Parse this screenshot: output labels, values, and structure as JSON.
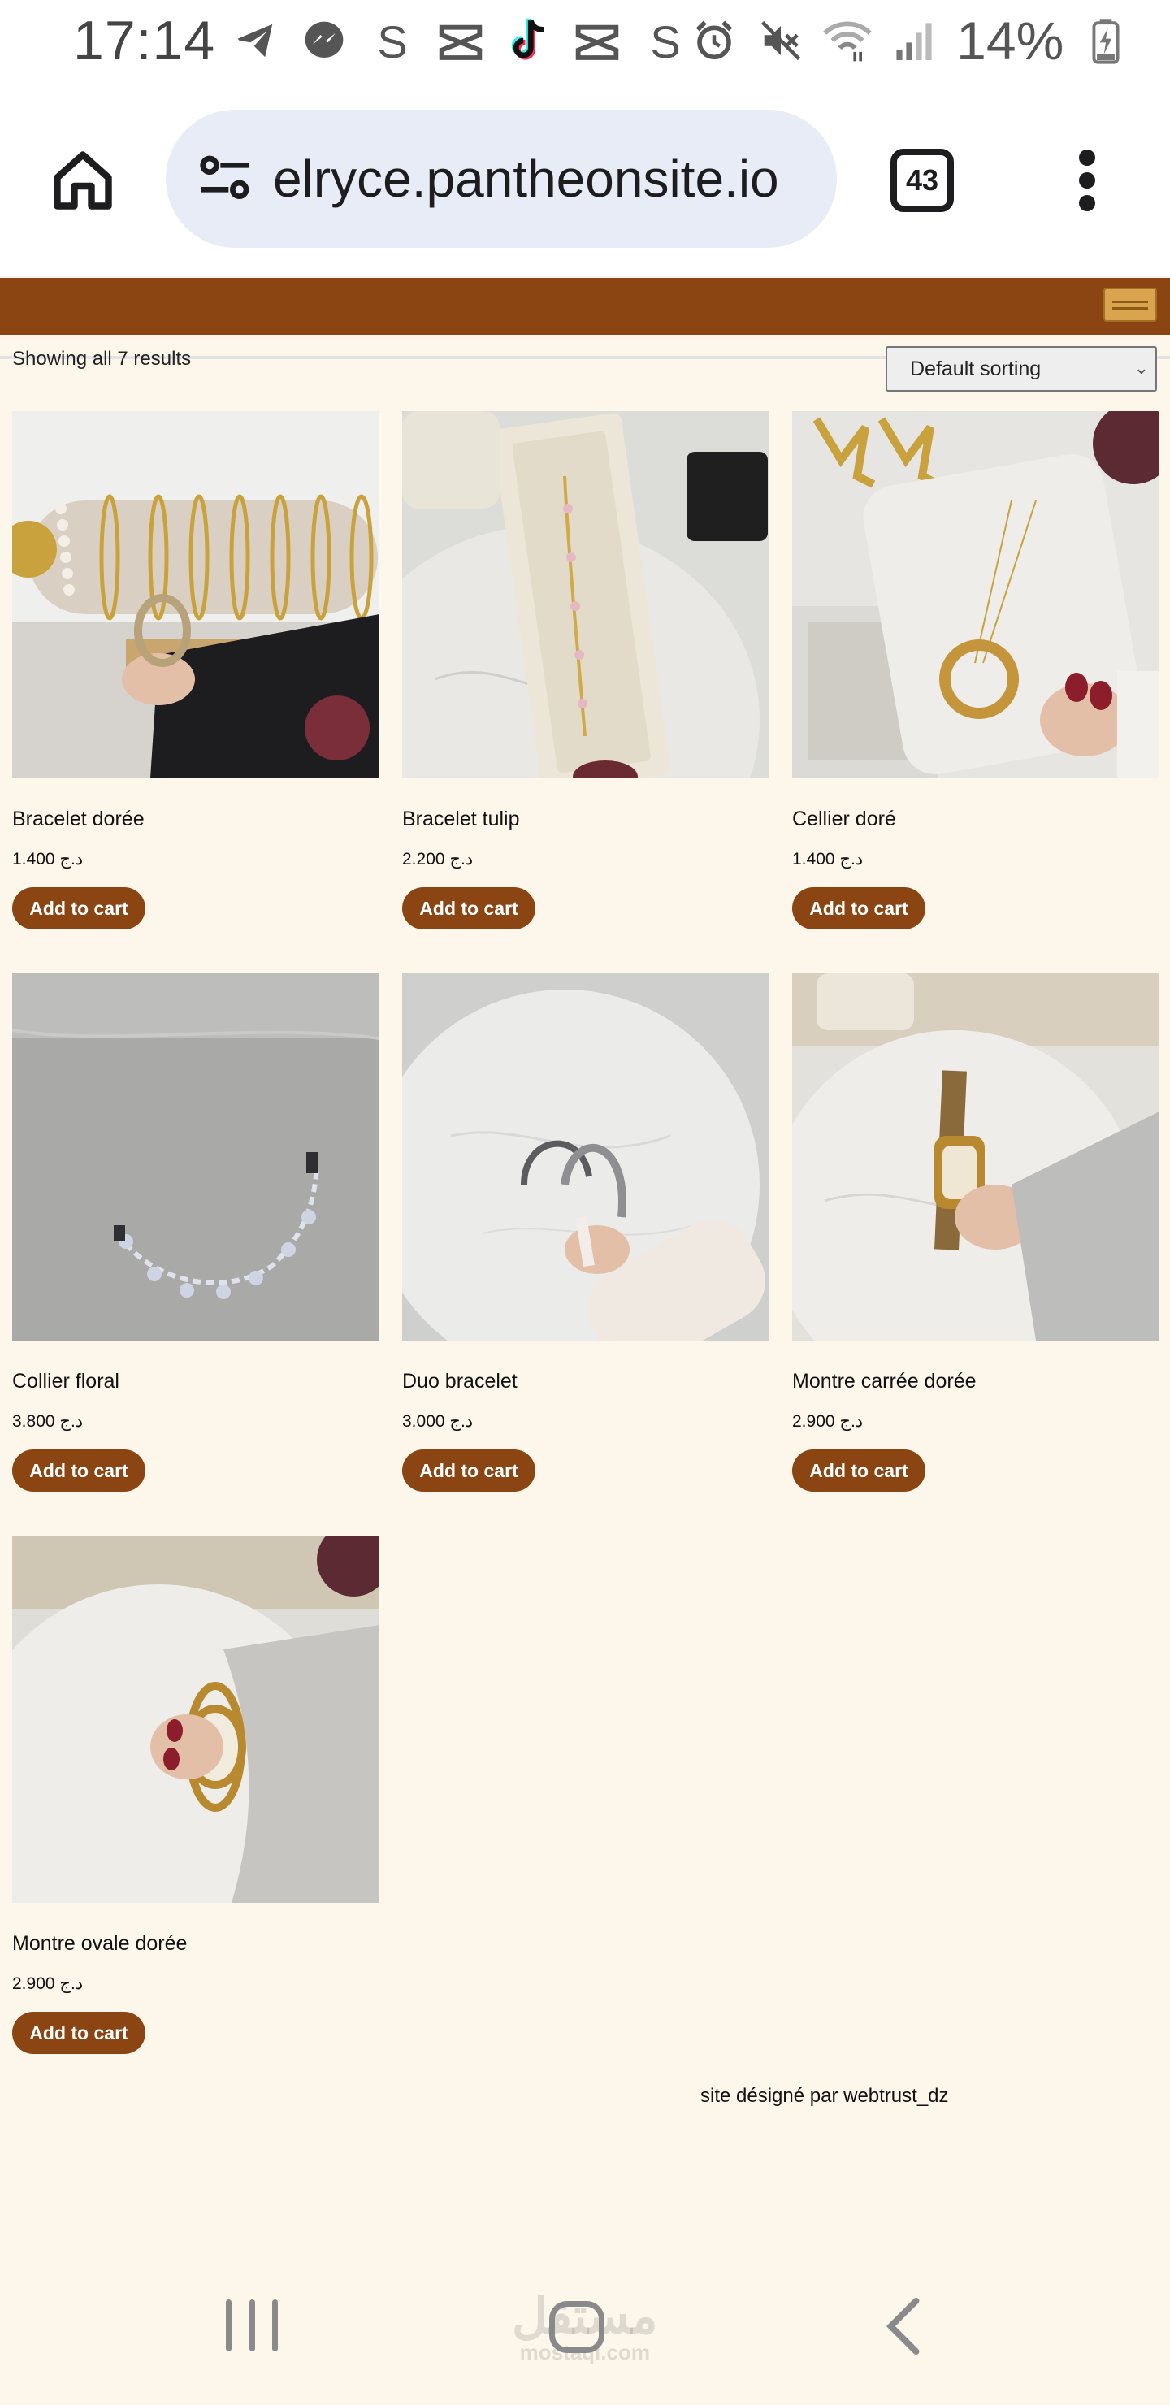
{
  "status_bar": {
    "time": "17:14",
    "battery": "14%",
    "left_icons": [
      "telegram-icon",
      "messenger-icon",
      "s-app-icon",
      "capcut-icon",
      "tiktok-icon",
      "capcut-icon",
      "s-app-icon"
    ],
    "right_icons": [
      "alarm-icon",
      "mute-icon",
      "wifi-icon",
      "signal-icon",
      "battery-charging-icon"
    ]
  },
  "browser": {
    "url": "elryce.pantheonsite.io",
    "tab_count": "43"
  },
  "shop": {
    "result_count": "Showing all 7 results",
    "sort_label": "Default sorting"
  },
  "products": [
    {
      "title": "Bracelet dorée",
      "price": "1.400 د.ج",
      "button": "Add to cart"
    },
    {
      "title": "Bracelet tulip",
      "price": "2.200 د.ج",
      "button": "Add to cart"
    },
    {
      "title": "Cellier doré",
      "price": "1.400 د.ج",
      "button": "Add to cart"
    },
    {
      "title": "Collier floral",
      "price": "3.800 د.ج",
      "button": "Add to cart"
    },
    {
      "title": "Duo bracelet",
      "price": "3.000 د.ج",
      "button": "Add to cart"
    },
    {
      "title": "Montre carrée dorée",
      "price": "2.900 د.ج",
      "button": "Add to cart"
    },
    {
      "title": "Montre ovale dorée",
      "price": "2.900 د.ج",
      "button": "Add to cart"
    }
  ],
  "footer": {
    "credit": "site désigné par webtrust_dz"
  },
  "colors": {
    "brand": "#8b4513",
    "page_background": "#fdf6ea",
    "toggle": "#d9a44d"
  },
  "watermark": {
    "main": "مستقل",
    "sub": "mostaql.com"
  }
}
